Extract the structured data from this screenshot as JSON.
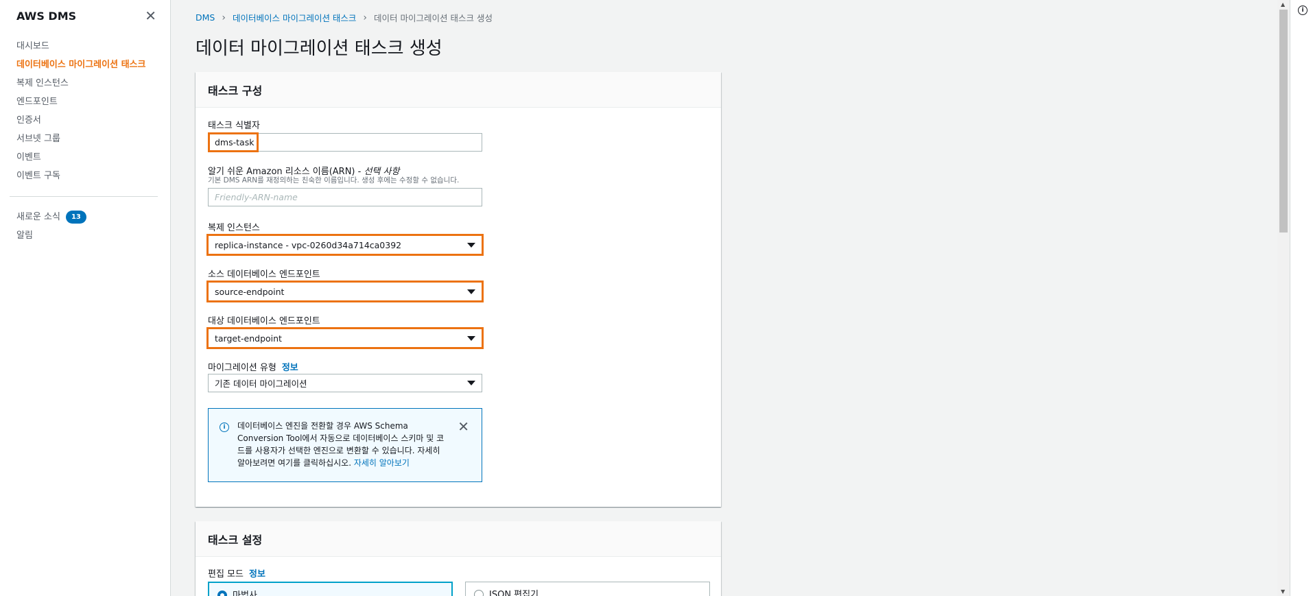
{
  "sidebar": {
    "title": "AWS DMS",
    "items": [
      {
        "label": "대시보드"
      },
      {
        "label": "데이터베이스 마이그레이션 태스크"
      },
      {
        "label": "복제 인스턴스"
      },
      {
        "label": "엔드포인트"
      },
      {
        "label": "인증서"
      },
      {
        "label": "서브넷 그룹"
      },
      {
        "label": "이벤트"
      },
      {
        "label": "이벤트 구독"
      }
    ],
    "news_label": "새로운 소식",
    "news_count": "13",
    "alerts_label": "알림"
  },
  "breadcrumb": {
    "root": "DMS",
    "parent": "데이터베이스 마이그레이션 태스크",
    "current": "데이터 마이그레이션 태스크 생성"
  },
  "page_title": "데이터 마이그레이션 태스크 생성",
  "task_config": {
    "heading": "태스크 구성",
    "task_id_label": "태스크 식별자",
    "task_id_value": "dms-task",
    "arn_label": "알기 쉬운 Amazon 리소스 이름(ARN) - ",
    "arn_optional": "선택 사항",
    "arn_desc": "기본 DMS ARN를 재정의하는 친숙한 이름입니다. 생성 후에는 수정할 수 없습니다.",
    "arn_placeholder": "Friendly-ARN-name",
    "replication_label": "복제 인스턴스",
    "replication_value": "replica-instance - vpc-0260d34a714ca0392",
    "source_label": "소스 데이터베이스 엔드포인트",
    "source_value": "source-endpoint",
    "target_label": "대상 데이터베이스 엔드포인트",
    "target_value": "target-endpoint",
    "migration_type_label": "마이그레이션 유형",
    "migration_type_info": "정보",
    "migration_type_value": "기존 데이터 마이그레이션",
    "alert_text": "데이터베이스 엔진을 전환할 경우 AWS Schema Conversion Tool에서 자동으로 데이터베이스 스키마 및 코드를 사용자가 선택한 엔진으로 변환할 수 있습니다. 자세히 알아보려면 여기를 클릭하십시오. ",
    "alert_link": "자세히 알아보기"
  },
  "task_settings": {
    "heading": "태스크 설정",
    "edit_mode_label": "편집 모드",
    "edit_mode_info": "정보",
    "mode_wizard": "마법사",
    "mode_json": "JSON 편집기"
  },
  "colors": {
    "accent": "#ec7211",
    "link": "#0073bb"
  }
}
